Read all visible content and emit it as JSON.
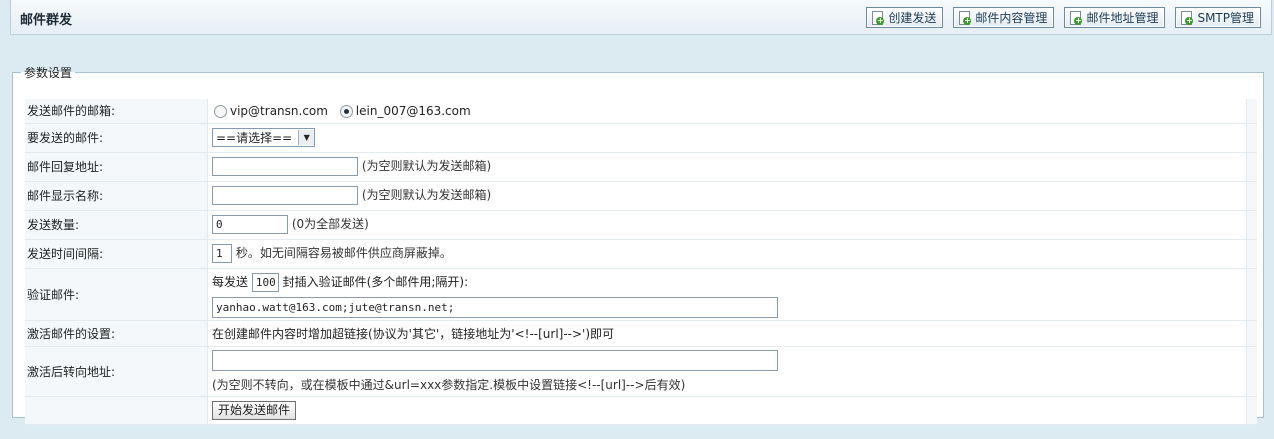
{
  "header": {
    "title": "邮件群发",
    "buttons": [
      {
        "label": "创建发送",
        "icon": "add-page-icon"
      },
      {
        "label": "邮件内容管理",
        "icon": "add-page-icon"
      },
      {
        "label": "邮件地址管理",
        "icon": "add-page-icon"
      },
      {
        "label": "SMTP管理",
        "icon": "add-page-icon"
      }
    ]
  },
  "settings": {
    "legend": "参数设置",
    "sender": {
      "label": "发送邮件的邮箱:",
      "options": [
        "vip@transn.com",
        "lein_007@163.com"
      ],
      "selected": "lein_007@163.com"
    },
    "mail_to_send": {
      "label": "要发送的邮件:",
      "value": "==请选择=="
    },
    "reply_to": {
      "label": "邮件回复地址:",
      "value": "",
      "hint": "(为空则默认为发送邮箱)"
    },
    "display_name": {
      "label": "邮件显示名称:",
      "value": "",
      "hint": "(为空则默认为发送邮箱)"
    },
    "send_count": {
      "label": "发送数量:",
      "value": "0",
      "hint": "(0为全部发送)"
    },
    "interval": {
      "label": "发送时间间隔:",
      "value": "1",
      "hint": "秒。如无间隔容易被邮件供应商屏蔽掉。"
    },
    "verify": {
      "label": "验证邮件:",
      "prefix": "每发送",
      "count": "100",
      "suffix": "封插入验证邮件(多个邮件用;隔开):",
      "emails": "yanhao.watt@163.com;jute@transn.net;"
    },
    "activate": {
      "label": "激活邮件的设置:",
      "text": "在创建邮件内容时增加超链接(协议为'其它'，链接地址为'<!--[url]-->')即可"
    },
    "redirect": {
      "label": "激活后转向地址:",
      "value": "",
      "hint": "(为空则不转向，或在模板中通过&url=xxx参数指定.模板中设置链接<!--[url]-->后有效)"
    },
    "submit_label": "开始发送邮件"
  }
}
